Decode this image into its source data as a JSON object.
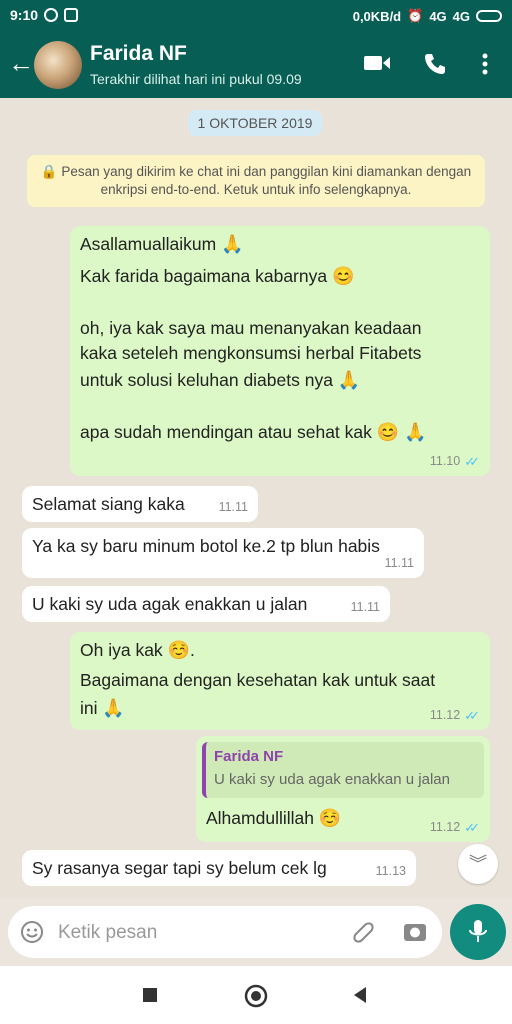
{
  "status_bar": {
    "time": "9:10",
    "network_speed": "0,0KB/d",
    "signal_1": "4G",
    "signal_2": "4G"
  },
  "header": {
    "contact_name": "Farida NF",
    "last_seen": "Terakhir dilihat hari ini pukul 09.09"
  },
  "chat": {
    "date_label": "1 OKTOBER 2019",
    "encryption_notice": "Pesan yang dikirim ke chat ini dan panggilan kini diamankan dengan enkripsi end-to-end. Ketuk untuk info selengkapnya.",
    "messages": [
      {
        "direction": "out",
        "lines": [
          "Asallamuallaikum",
          "Kak farida bagaimana kabarnya",
          "",
          "oh, iya kak saya mau menanyakan keadaan",
          "kaka seteleh mengkonsumsi herbal Fitabets",
          "untuk solusi keluhan diabets nya",
          "",
          "apa sudah mendingan atau sehat kak"
        ],
        "time": "11.10"
      },
      {
        "direction": "in",
        "text": "Selamat siang kaka",
        "time": "11.11"
      },
      {
        "direction": "in",
        "text": "Ya ka sy baru minum botol ke.2 tp blun habis",
        "time": "11.11"
      },
      {
        "direction": "in",
        "text": "U kaki sy uda agak enakkan u jalan",
        "time": "11.11"
      },
      {
        "direction": "out",
        "lines": [
          "Oh iya kak",
          "Bagaimana dengan kesehatan kak untuk saat",
          "ini"
        ],
        "time": "11.12"
      },
      {
        "direction": "out",
        "quote_name": "Farida NF",
        "quote_text": "U kaki sy uda agak enakkan u jalan",
        "text": "Alhamdullillah",
        "time": "11.12"
      },
      {
        "direction": "in",
        "text": "Sy rasanya segar tapi sy belum cek lg",
        "time": "11.13"
      }
    ]
  },
  "input": {
    "placeholder": "Ketik pesan"
  },
  "colors": {
    "header": "#075e54",
    "outgoing": "#dcf8c6",
    "incoming": "#ffffff",
    "mic": "#128c7e",
    "read_tick": "#4fc3f7"
  },
  "icons": [
    "whatsapp-icon",
    "upload-icon",
    "back-arrow-icon",
    "video-call-icon",
    "phone-icon",
    "more-icon",
    "lock-icon",
    "emoji-icon",
    "attach-icon",
    "camera-icon",
    "mic-icon",
    "scroll-down-icon"
  ]
}
